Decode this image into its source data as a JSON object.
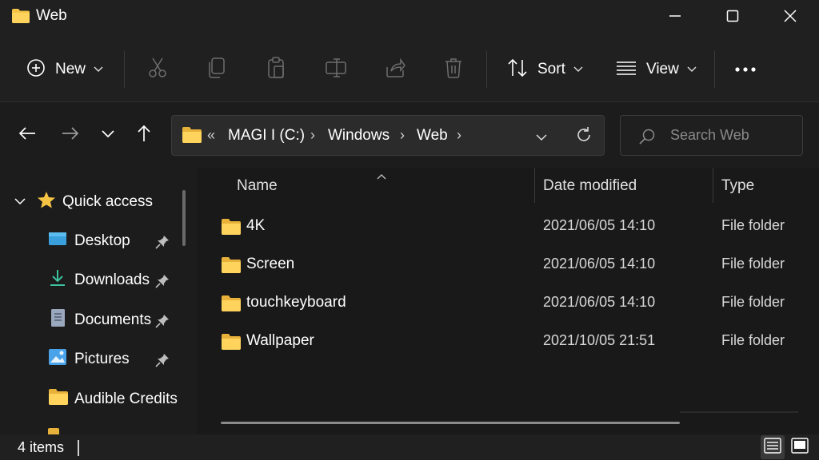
{
  "window": {
    "title": "Web",
    "minimize_icon": "minimize-icon",
    "maximize_icon": "maximize-icon",
    "close_icon": "close-icon"
  },
  "toolbar": {
    "new_label": "New",
    "sort_label": "Sort",
    "view_label": "View",
    "icons": [
      "add-circle-icon",
      "cut-icon",
      "copy-icon",
      "paste-icon",
      "rename-icon",
      "share-icon",
      "delete-icon",
      "sort-icon",
      "view-list-icon",
      "more-icon"
    ]
  },
  "address": {
    "overflow": "«",
    "crumbs": [
      "MAGI I (C:)",
      "Windows",
      "Web"
    ],
    "separator": "›"
  },
  "search": {
    "placeholder": "Search Web"
  },
  "navigation": {
    "quick_access": "Quick access",
    "items": [
      {
        "label": "Desktop",
        "icon": "desktop-icon",
        "pinned": true
      },
      {
        "label": "Downloads",
        "icon": "downloads-icon",
        "pinned": true
      },
      {
        "label": "Documents",
        "icon": "documents-icon",
        "pinned": true
      },
      {
        "label": "Pictures",
        "icon": "pictures-icon",
        "pinned": true
      },
      {
        "label": "Audible Credits",
        "icon": "folder-icon",
        "pinned": false
      }
    ]
  },
  "columns": {
    "name": "Name",
    "date": "Date modified",
    "type": "Type"
  },
  "files": [
    {
      "name": "4K",
      "date": "2021/06/05 14:10",
      "type": "File folder"
    },
    {
      "name": "Screen",
      "date": "2021/06/05 14:10",
      "type": "File folder"
    },
    {
      "name": "touchkeyboard",
      "date": "2021/06/05 14:10",
      "type": "File folder"
    },
    {
      "name": "Wallpaper",
      "date": "2021/10/05 21:51",
      "type": "File folder"
    }
  ],
  "status": {
    "items_count": "4 items"
  },
  "colors": {
    "folder": "#f6c445",
    "background": "#1c1c1c",
    "accent": "#5aa0e8"
  }
}
